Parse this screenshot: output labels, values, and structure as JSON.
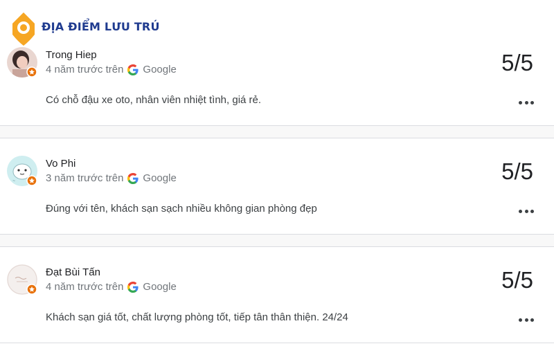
{
  "watermark": {
    "text": "ĐỊA ĐIỂM LƯU TRÚ",
    "color": "#1f3b8f",
    "pin_color": "#f6a623"
  },
  "source_label": "Google",
  "reviews": [
    {
      "name": "Trong Hiep",
      "time": "4 năm trước trên",
      "rating": "5/5",
      "text": "Có chỗ đậu xe oto, nhân viên nhiệt tình, giá rẻ."
    },
    {
      "name": "Vo Phi",
      "time": "3 năm trước trên",
      "rating": "5/5",
      "text": "Đúng với tên, khách sạn sạch nhiều không gian phòng đẹp"
    },
    {
      "name": "Đạt Bùi Tấn",
      "time": "4 năm trước trên",
      "rating": "5/5",
      "text": "Khách sạn giá tốt, chất lượng phòng tốt, tiếp tân thân thiện. 24/24"
    }
  ],
  "colors": {
    "badge": "#e8710a",
    "divider": "#dadce0",
    "meta_text": "#70757a"
  }
}
